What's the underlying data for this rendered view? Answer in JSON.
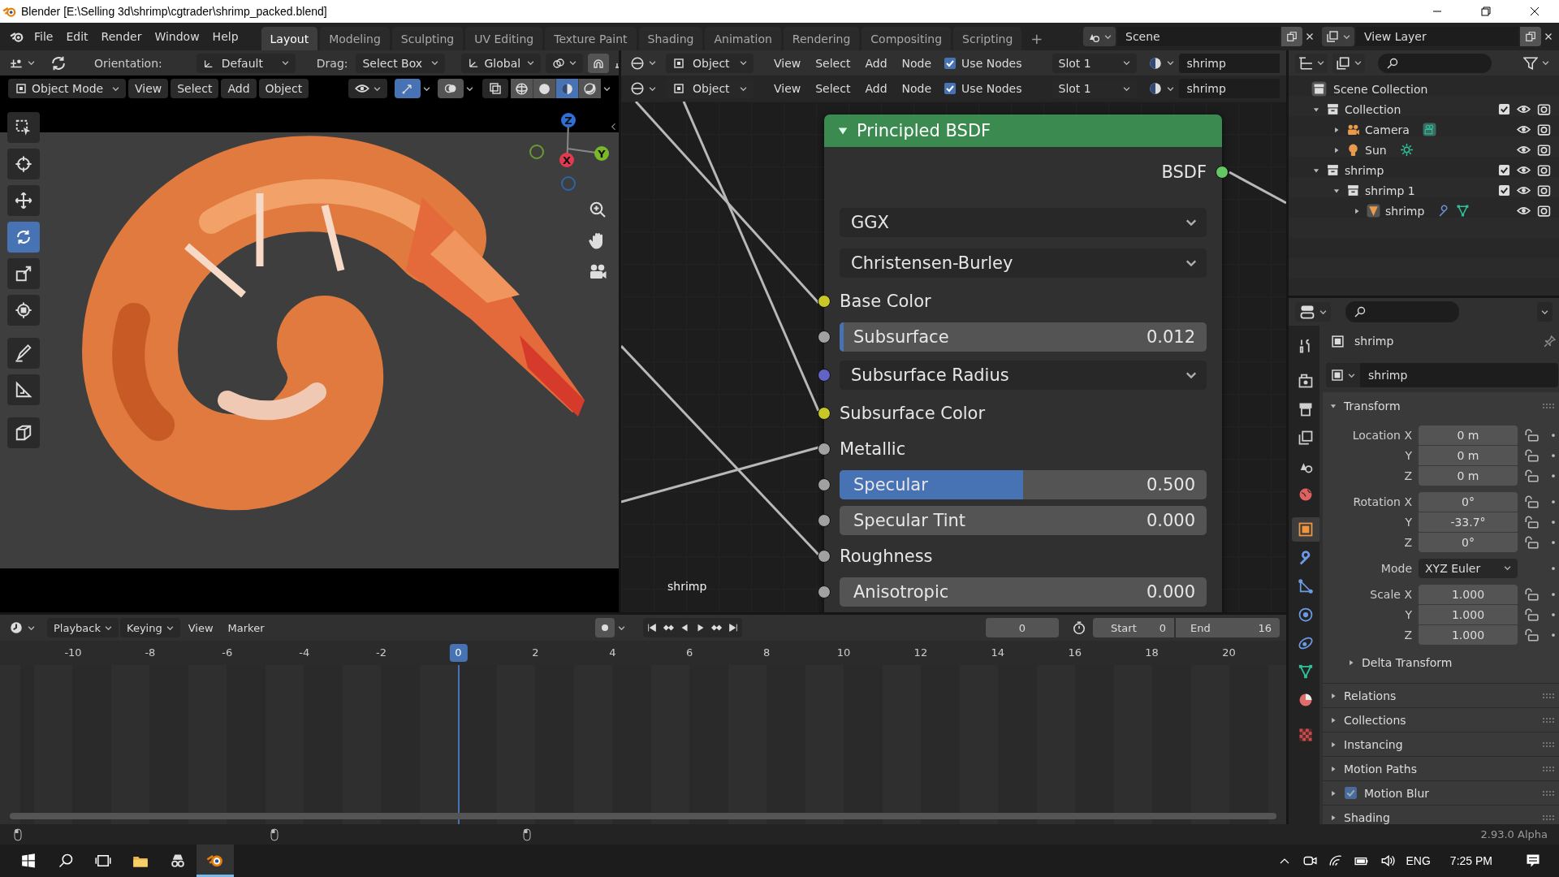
{
  "window": {
    "title": "Blender [E:\\Selling 3d\\shrimp\\cgtrader\\shrimp_packed.blend]"
  },
  "menu": [
    "File",
    "Edit",
    "Render",
    "Window",
    "Help"
  ],
  "workspaces": [
    {
      "label": "Layout",
      "selected": true
    },
    {
      "label": "Modeling",
      "selected": false
    },
    {
      "label": "Sculpting",
      "selected": false
    },
    {
      "label": "UV Editing",
      "selected": false
    },
    {
      "label": "Texture Paint",
      "selected": false
    },
    {
      "label": "Shading",
      "selected": false
    },
    {
      "label": "Animation",
      "selected": false
    },
    {
      "label": "Rendering",
      "selected": false
    },
    {
      "label": "Compositing",
      "selected": false
    },
    {
      "label": "Scripting",
      "selected": false
    }
  ],
  "add_workspace": "+",
  "scene": "Scene",
  "view_layer": "View Layer",
  "viewport": {
    "tool_settings": {
      "orientation_label": "Orientation:",
      "orientation": "Default",
      "drag_label": "Drag:",
      "drag": "Select Box",
      "transform_orientation": "Global"
    },
    "mode": "Object Mode",
    "menus": [
      "View",
      "Select",
      "Add",
      "Object"
    ],
    "shading": [
      {
        "kind": "wireframe",
        "selected": false
      },
      {
        "kind": "solid",
        "selected": false
      },
      {
        "kind": "material",
        "selected": true
      },
      {
        "kind": "rendered",
        "selected": false
      }
    ],
    "tools": [
      {
        "kind": "select_box",
        "selected": false
      },
      {
        "kind": "cursor",
        "selected": false
      },
      {
        "kind": "move",
        "selected": false
      },
      {
        "kind": "rotate",
        "selected": true
      },
      {
        "kind": "scale",
        "selected": false
      },
      {
        "kind": "transform",
        "selected": false
      },
      {
        "kind": "annotate",
        "selected": false
      },
      {
        "kind": "measure",
        "selected": false
      },
      {
        "kind": "add_cube",
        "selected": false
      }
    ],
    "gizmo_axes": [
      "Z",
      "X",
      "Y"
    ]
  },
  "node_editor": {
    "headers": [
      {
        "object_type": "Object",
        "menus": [
          "View",
          "Select",
          "Add",
          "Node"
        ],
        "use_nodes": {
          "label": "Use Nodes",
          "checked": true
        },
        "slot": "Slot 1",
        "material": "shrimp"
      },
      {
        "object_type": "Object",
        "menus": [
          "View",
          "Select",
          "Add",
          "Node"
        ],
        "use_nodes": {
          "label": "Use Nodes",
          "checked": true
        },
        "slot": "Slot 1",
        "material": "shrimp"
      }
    ],
    "node": {
      "title": "Principled BSDF",
      "output": {
        "label": "BSDF",
        "color": "#63c763"
      },
      "rows": [
        {
          "kind": "menu",
          "value": "GGX"
        },
        {
          "kind": "menu",
          "value": "Christensen-Burley"
        },
        {
          "kind": "socket",
          "label": "Base Color",
          "color": "#c7c729"
        },
        {
          "kind": "slider",
          "label": "Subsurface",
          "value": "0.012",
          "level": 0.012,
          "color": "#a1a1a1"
        },
        {
          "kind": "menu",
          "value": "Subsurface Radius",
          "color": "#6363c7"
        },
        {
          "kind": "socket",
          "label": "Subsurface Color",
          "color": "#c7c729"
        },
        {
          "kind": "socket",
          "label": "Metallic",
          "color": "#a1a1a1"
        },
        {
          "kind": "slider",
          "label": "Specular",
          "value": "0.500",
          "level": 0.5,
          "color": "#a1a1a1"
        },
        {
          "kind": "slider",
          "label": "Specular Tint",
          "value": "0.000",
          "level": 0,
          "color": "#a1a1a1"
        },
        {
          "kind": "socket",
          "label": "Roughness",
          "color": "#a1a1a1"
        },
        {
          "kind": "slider",
          "label": "Anisotropic",
          "value": "0.000",
          "level": 0,
          "color": "#a1a1a1"
        }
      ]
    },
    "frame_label": "shrimp"
  },
  "outliner": {
    "root": "Scene Collection",
    "tree": [
      {
        "label": "Collection",
        "kind": "collection",
        "expanded": true,
        "checked": true,
        "children": [
          {
            "label": "Camera",
            "kind": "camera",
            "expanded": false
          },
          {
            "label": "Sun",
            "kind": "light",
            "expanded": false
          }
        ]
      },
      {
        "label": "shrimp",
        "kind": "collection",
        "expanded": true,
        "checked": true,
        "children": [
          {
            "label": "shrimp 1",
            "kind": "collection",
            "expanded": true,
            "checked": true,
            "children": [
              {
                "label": "shrimp",
                "kind": "mesh",
                "expanded": false
              }
            ]
          }
        ]
      }
    ]
  },
  "properties": {
    "tabs": [
      {
        "kind": "tool",
        "selected": false
      },
      {
        "kind": "render",
        "selected": false
      },
      {
        "kind": "output",
        "selected": false
      },
      {
        "kind": "view_layer",
        "selected": false
      },
      {
        "kind": "scene",
        "selected": false
      },
      {
        "kind": "world",
        "selected": false
      },
      {
        "kind": "object",
        "selected": true
      },
      {
        "kind": "modifiers",
        "selected": false
      },
      {
        "kind": "particles",
        "selected": false
      },
      {
        "kind": "physics",
        "selected": false
      },
      {
        "kind": "constraints",
        "selected": false
      },
      {
        "kind": "data",
        "selected": false
      },
      {
        "kind": "material",
        "selected": false
      },
      {
        "kind": "texture",
        "selected": false
      }
    ],
    "object": "shrimp",
    "datablock": "shrimp",
    "transform": {
      "label": "Transform",
      "expanded": true,
      "groups": [
        {
          "rows": [
            {
              "kind": "field",
              "label": "Location X",
              "value": "0 m"
            },
            {
              "kind": "field",
              "label": "Y",
              "value": "0 m"
            },
            {
              "kind": "field",
              "label": "Z",
              "value": "0 m"
            }
          ]
        },
        {
          "rows": [
            {
              "kind": "field",
              "label": "Rotation X",
              "value": "0°"
            },
            {
              "kind": "field",
              "label": "Y",
              "value": "-33.7°"
            },
            {
              "kind": "field",
              "label": "Z",
              "value": "0°"
            }
          ]
        },
        {
          "rows": [
            {
              "kind": "menu",
              "label": "Mode",
              "value": "XYZ Euler"
            }
          ]
        },
        {
          "rows": [
            {
              "kind": "field",
              "label": "Scale X",
              "value": "1.000"
            },
            {
              "kind": "field",
              "label": "Y",
              "value": "1.000"
            },
            {
              "kind": "field",
              "label": "Z",
              "value": "1.000"
            }
          ]
        }
      ],
      "subpanels": [
        {
          "label": "Delta Transform",
          "expanded": false
        }
      ]
    },
    "panels": [
      {
        "label": "Relations",
        "kind": "plain",
        "expanded": false
      },
      {
        "label": "Collections",
        "kind": "plain",
        "expanded": false
      },
      {
        "label": "Instancing",
        "kind": "plain",
        "expanded": false
      },
      {
        "label": "Motion Paths",
        "kind": "plain",
        "expanded": false
      },
      {
        "label": "Motion Blur",
        "kind": "checkbox",
        "checked": true,
        "expanded": false
      },
      {
        "label": "Shading",
        "kind": "plain",
        "expanded": false
      }
    ]
  },
  "timeline": {
    "menus": [
      "Playback",
      "Keying",
      "View",
      "Marker"
    ],
    "current_frame": "0",
    "start_label": "Start",
    "start": "0",
    "end_label": "End",
    "end": "16",
    "ticks": [
      {
        "label": "-10",
        "selected": false
      },
      {
        "label": "-8",
        "selected": false
      },
      {
        "label": "-6",
        "selected": false
      },
      {
        "label": "-4",
        "selected": false
      },
      {
        "label": "-2",
        "selected": false
      },
      {
        "label": "0",
        "selected": true
      },
      {
        "label": "2",
        "selected": false
      },
      {
        "label": "4",
        "selected": false
      },
      {
        "label": "6",
        "selected": false
      },
      {
        "label": "8",
        "selected": false
      },
      {
        "label": "10",
        "selected": false
      },
      {
        "label": "12",
        "selected": false
      },
      {
        "label": "14",
        "selected": false
      },
      {
        "label": "16",
        "selected": false
      },
      {
        "label": "18",
        "selected": false
      },
      {
        "label": "20",
        "selected": false
      }
    ]
  },
  "status_bar": {
    "version": "2.93.0 Alpha"
  },
  "taskbar": {
    "language": "ENG",
    "time": "7:25 PM"
  }
}
